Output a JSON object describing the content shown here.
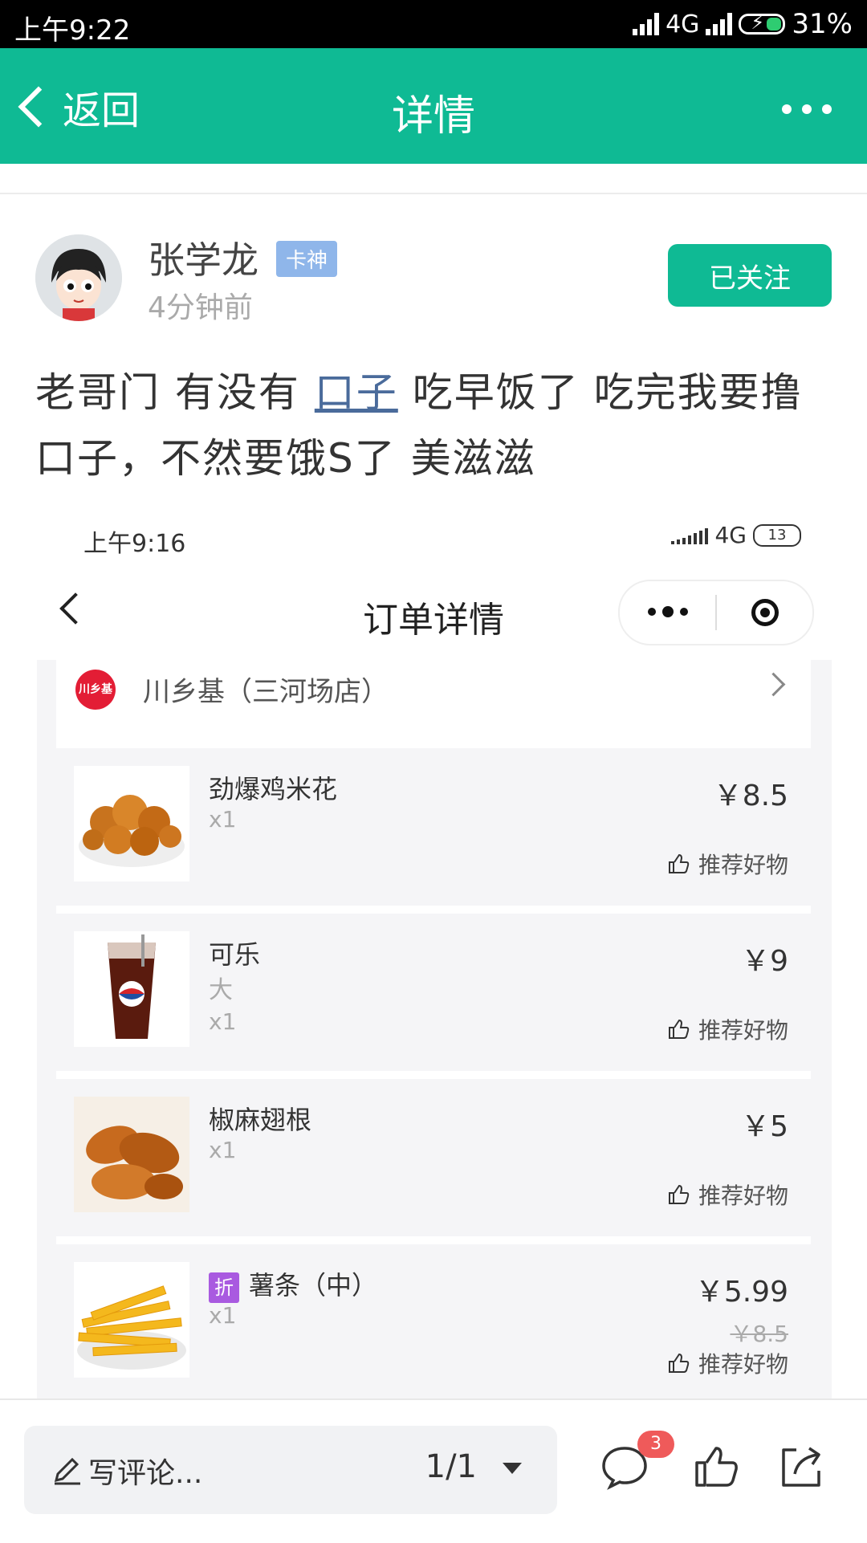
{
  "status_bar": {
    "time": "上午9:22",
    "network": "4G",
    "battery": "31%"
  },
  "nav": {
    "back_label": "返回",
    "title": "详情"
  },
  "author": {
    "name": "张学龙",
    "badge": "卡神",
    "time": "4分钟前",
    "follow_label": "已关注"
  },
  "post": {
    "text_part1": "老哥门  有没有 ",
    "link": "口子",
    "text_part2": "  吃早饭了  吃完我要撸口子，不然要饿S了  美滋滋"
  },
  "screenshot": {
    "time": "上午9:16",
    "network": "4G",
    "battery": "13",
    "title": "订单详情",
    "store_name": "川乡基（三河场店）",
    "store_logo_text": "川乡基",
    "items": [
      {
        "name": "劲爆鸡米花",
        "spec": "",
        "qty": "x1",
        "price": "￥8.5",
        "old_price": "",
        "recommend": "推荐好物",
        "discount": ""
      },
      {
        "name": "可乐",
        "spec": "大",
        "qty": "x1",
        "price": "￥9",
        "old_price": "",
        "recommend": "推荐好物",
        "discount": ""
      },
      {
        "name": "椒麻翅根",
        "spec": "",
        "qty": "x1",
        "price": "￥5",
        "old_price": "",
        "recommend": "推荐好物",
        "discount": ""
      },
      {
        "name": "薯条（中）",
        "spec": "",
        "qty": "x1",
        "price": "￥5.99",
        "old_price": "￥8.5",
        "recommend": "推荐好物",
        "discount": "折"
      }
    ]
  },
  "bottom_bar": {
    "comment_placeholder": "写评论...",
    "page_indicator": "1/1",
    "comment_count": "3"
  },
  "colors": {
    "brand": "#0fba94",
    "badge": "#8fb6ea",
    "notif": "#ef5a5a",
    "discount": "#a95ae0"
  }
}
